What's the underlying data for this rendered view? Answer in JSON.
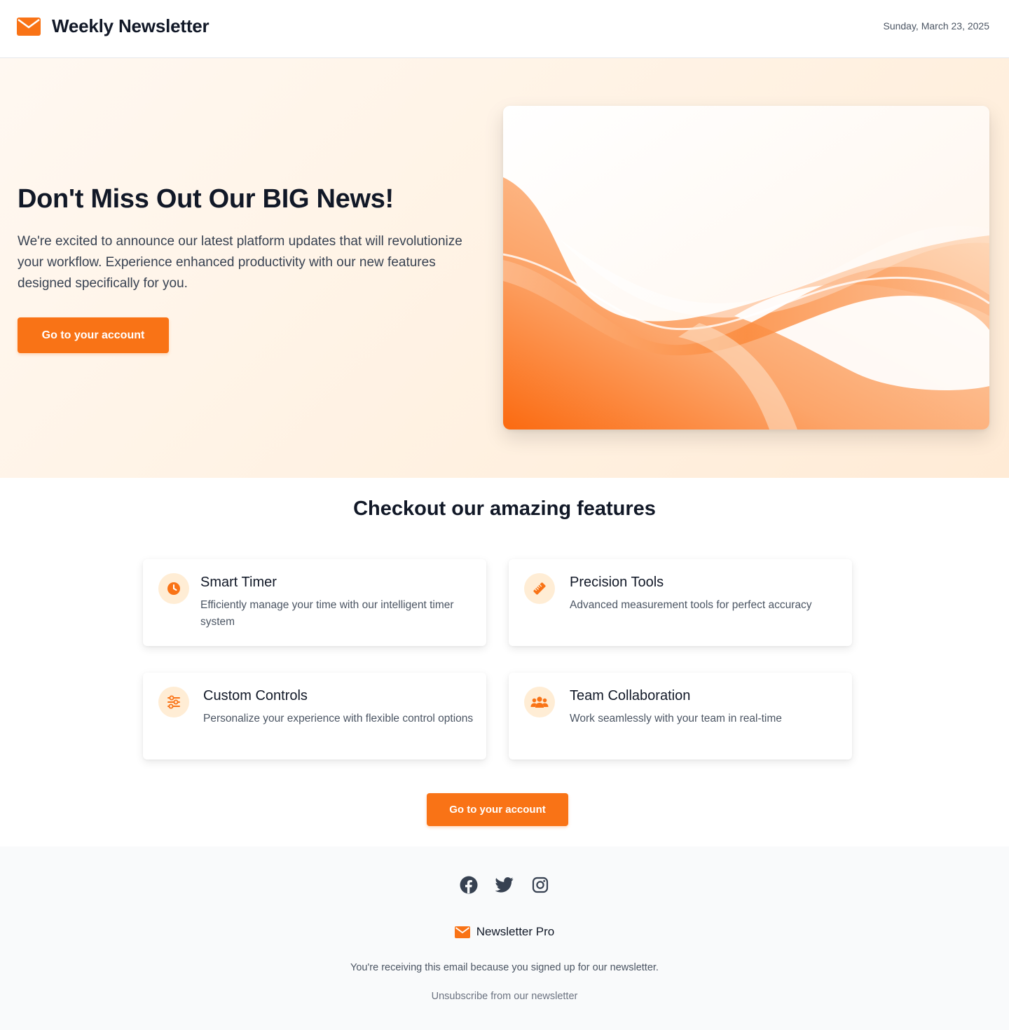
{
  "header": {
    "title": "Weekly Newsletter",
    "date": "Sunday, March 23, 2025"
  },
  "hero": {
    "title": "Don't Miss Out Our BIG News!",
    "text": "We're excited to announce our latest platform updates that will revolutionize your workflow. Experience enhanced productivity with our new features designed specifically for you.",
    "button_label": "Go to your account"
  },
  "features": {
    "title": "Checkout our amazing features",
    "items": [
      {
        "title": "Smart Timer",
        "description": "Efficiently manage your time with our intelligent timer system",
        "icon": "clock-icon"
      },
      {
        "title": "Precision Tools",
        "description": "Advanced measurement tools for perfect accuracy",
        "icon": "ruler-icon"
      },
      {
        "title": "Custom Controls",
        "description": "Personalize your experience with flexible control options",
        "icon": "sliders-icon"
      },
      {
        "title": "Team Collaboration",
        "description": "Work seamlessly with your team in real-time",
        "icon": "users-icon"
      }
    ],
    "button_label": "Go to your account"
  },
  "footer": {
    "socials": [
      "facebook-icon",
      "twitter-icon",
      "instagram-icon"
    ],
    "brand": "Newsletter Pro",
    "note": "You're receiving this email because you signed up for our newsletter.",
    "unsubscribe": "Unsubscribe from our newsletter"
  },
  "colors": {
    "accent": "#f97316",
    "accent_light": "#ffedd5",
    "text_dark": "#111827",
    "text_muted": "#4b5563",
    "footer_bg": "#f9fafb"
  }
}
